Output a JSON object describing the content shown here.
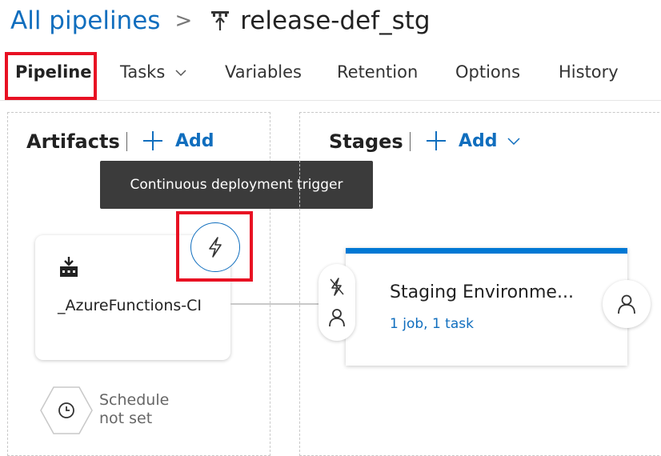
{
  "breadcrumb": {
    "root": "All pipelines",
    "separator": ">",
    "title": "release-def_stg"
  },
  "tabs": [
    {
      "label": "Pipeline",
      "active": true
    },
    {
      "label": "Tasks",
      "has_dropdown": true
    },
    {
      "label": "Variables"
    },
    {
      "label": "Retention"
    },
    {
      "label": "Options"
    },
    {
      "label": "History"
    }
  ],
  "artifacts": {
    "title": "Artifacts",
    "add_label": "Add",
    "tooltip": "Continuous deployment trigger",
    "artifact_name": "_AzureFunctions-CI",
    "schedule_line1": "Schedule",
    "schedule_line2": "not set"
  },
  "stages": {
    "title": "Stages",
    "add_label": "Add",
    "stage_name": "Staging Environme...",
    "stage_details": "1 job, 1 task"
  },
  "colors": {
    "accent": "#106ebe",
    "highlight": "#e81123",
    "stage_top_bar": "#0078d4",
    "tooltip_bg": "#3b3b3b"
  },
  "icons": [
    "chevron-right-icon",
    "pipeline-icon",
    "chevron-down-icon",
    "plus-icon",
    "lightning-icon",
    "build-artifact-icon",
    "clock-icon",
    "pre-deployment-trigger-icon",
    "person-icon"
  ]
}
